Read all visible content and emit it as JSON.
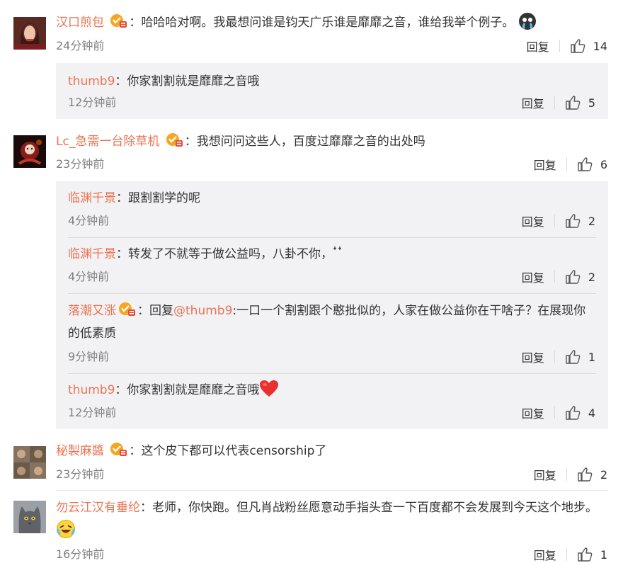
{
  "colon": "：",
  "reply_label": "回复",
  "comments": [
    {
      "username": "汉口煎包",
      "text": "哈哈哈对啊。我最想问谁是钧天广乐谁是靡靡之音，谁给我举个例子。",
      "time": "24分钟前",
      "likes": "14",
      "replies": [
        {
          "username": "thumb9",
          "text": "你家割割就是靡靡之音哦",
          "time": "12分钟前",
          "likes": "5"
        }
      ]
    },
    {
      "username": "Lc_急需一台除草机",
      "text": "我想问问这些人，百度过靡靡之音的出处吗",
      "time": "23分钟前",
      "likes": "6",
      "replies": [
        {
          "username": "临渊千景",
          "text": "跟割割学的呢",
          "time": "4分钟前",
          "likes": "2"
        },
        {
          "username": "临渊千景",
          "text": "转发了不就等于做公益吗，八卦不你，",
          "time": "4分钟前",
          "likes": "2"
        },
        {
          "username": "落潮又涨",
          "text_prefix": "回复",
          "mention": "@thumb9",
          "text": ":一口一个割割跟个憨批似的，人家在做公益你在干啥子？在展现你的低素质",
          "time": "9分钟前",
          "likes": "1"
        },
        {
          "username": "thumb9",
          "text": "你家割割就是靡靡之音哦",
          "time": "12分钟前",
          "likes": "4"
        }
      ]
    },
    {
      "username": "秘製麻醬",
      "text": "这个皮下都可以代表censorship了",
      "time": "23分钟前",
      "likes": "2"
    },
    {
      "username": "勿云江汉有垂纶",
      "text": "老师，你快跑。但凡肖战粉丝愿意动手指头查一下百度都不会发展到今天这个地步。",
      "time": "16分钟前",
      "likes": "1"
    }
  ]
}
